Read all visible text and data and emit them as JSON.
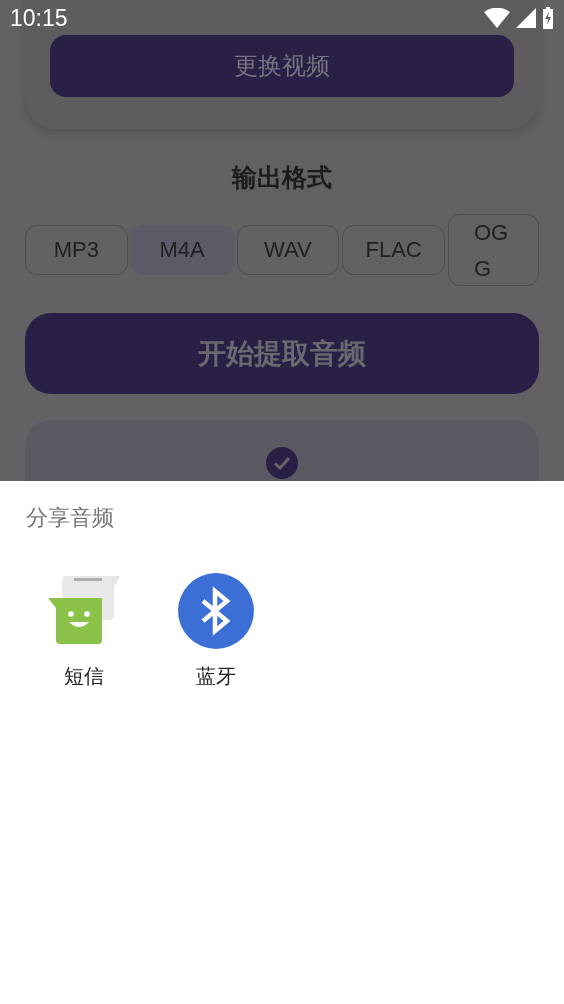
{
  "status_bar": {
    "time": "10:15"
  },
  "background_screen": {
    "replace_video_button": "更换视频",
    "output_format": {
      "title": "输出格式",
      "options": [
        {
          "label": "MP3",
          "selected": false
        },
        {
          "label": "M4A",
          "selected": true
        },
        {
          "label": "WAV",
          "selected": false
        },
        {
          "label": "FLAC",
          "selected": false
        },
        {
          "label": "OGG",
          "selected": false
        }
      ]
    },
    "extract_button": "开始提取音频"
  },
  "share_sheet": {
    "title": "分享音频",
    "apps": [
      {
        "label": "短信",
        "kind": "messaging"
      },
      {
        "label": "蓝牙",
        "kind": "bluetooth"
      }
    ]
  }
}
